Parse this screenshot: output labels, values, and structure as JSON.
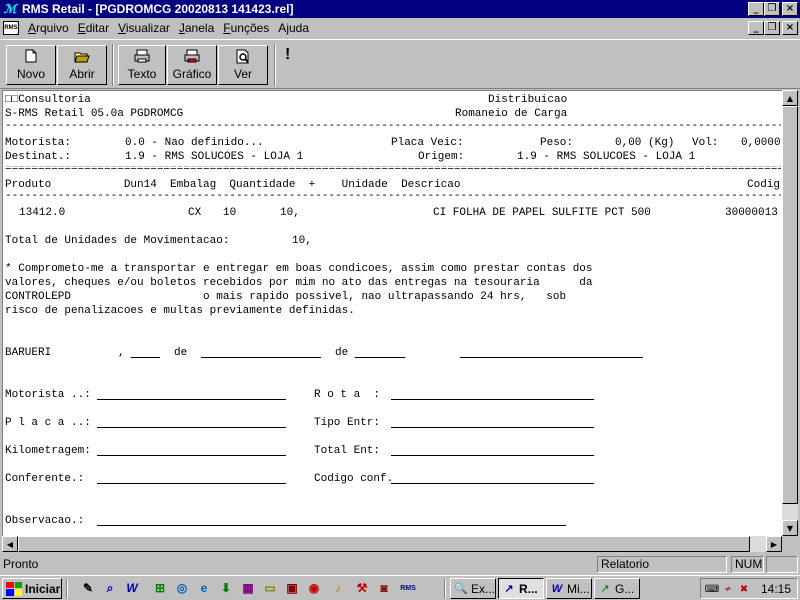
{
  "window": {
    "title": "RMS Retail - [PGDROMCG 20020813 141423.rel]",
    "minimize": "_",
    "maximize": "❐",
    "close": "×"
  },
  "menu": {
    "items": [
      "Arquivo",
      "Editar",
      "Visualizar",
      "Janela",
      "Funções",
      "Ajuda"
    ]
  },
  "toolbar": {
    "buttons": [
      {
        "label": "Novo",
        "icon": "new-document-icon"
      },
      {
        "label": "Abrir",
        "icon": "open-folder-icon"
      },
      {
        "label": "Texto",
        "icon": "print-text-icon"
      },
      {
        "label": "Gráfico",
        "icon": "print-graphic-icon"
      },
      {
        "label": "Ver",
        "icon": "preview-icon"
      }
    ],
    "alert": "!"
  },
  "report": {
    "header_left_1": "□□Consultoria",
    "header_right_1": "Distribuicao",
    "header_left_2": "S-RMS Retail 05.0a PGDROMCG",
    "header_right_2": "Romaneio de Carga",
    "motorista_label": "Motorista:",
    "motorista_value": "0.0 - Nao definido...",
    "placa_veic_label": "Placa Veic:",
    "peso_label": "Peso:",
    "peso_value": "0,00 (Kg)",
    "vol_label": "Vol:",
    "vol_value": "0,0000",
    "destinat_label": "Destinat.:",
    "destinat_value": "1.9 - RMS SOLUCOES - LOJA 1",
    "origem_label": "Origem:",
    "origem_value": "1.9 - RMS SOLUCOES - LOJA 1",
    "col_headers": "Produto           Dun14  Embalag  Quantidade  +    Unidade  Descricao",
    "col_codigo": "Codig",
    "row_produto": "13412.0",
    "row_embalag": "CX",
    "row_qtd": "10",
    "row_quantidade": "10,",
    "row_descricao": "CI FOLHA DE PAPEL SULFITE PCT 500",
    "row_codigo": "30000013",
    "total_label": "Total de Unidades de Movimentacao:",
    "total_value": "10,",
    "text_1": "* Comprometo-me a transportar e entregar em boas condicoes, assim como prestar contas dos",
    "text_2": "valores, cheques e/ou boletos recebidos por mim no ato das entregas na tesouraria      da",
    "text_3": "CONTROLEPD                    o mais rapido possivel, nao ultrapassando 24 hrs,   sob",
    "text_4": "risco de penalizacoes e multas previamente definidas.",
    "city": "BARUERI",
    "comma": ",",
    "de_1": "de",
    "de_2": "de",
    "f_motorista": "Motorista ..:",
    "f_rota": "R o t a  :",
    "f_placa": "P l a c a ..:",
    "f_tipo": "Tipo Entr:",
    "f_km": "Kilometragem:",
    "f_total": "Total Ent:",
    "f_conferente": "Conferente.:",
    "f_codigo": "Codigo conf.",
    "f_obs": "Observacao.:"
  },
  "statusbar": {
    "text": "Pronto",
    "mode": "Relatorio",
    "num": "NUM"
  },
  "taskbar": {
    "start": "Iniciar",
    "tasks": [
      {
        "label": "Ex...",
        "icon": "explorer-icon",
        "active": false
      },
      {
        "label": "R...",
        "icon": "rms-retail-icon",
        "active": true
      },
      {
        "label": "Mi...",
        "icon": "word-icon",
        "active": false
      },
      {
        "label": "G...",
        "icon": "graphic-app-icon",
        "active": false
      }
    ],
    "clock": "14:15"
  }
}
